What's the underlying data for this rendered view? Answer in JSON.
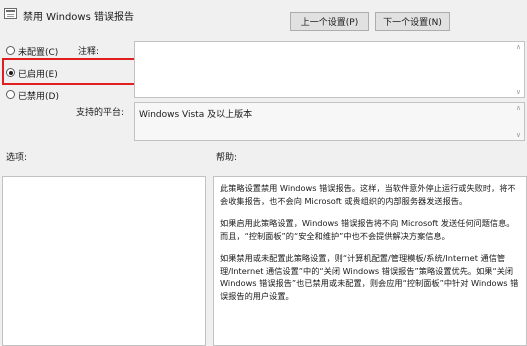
{
  "window": {
    "title": "禁用 Windows 错误报告",
    "icon": "policy-setting-icon"
  },
  "nav": {
    "prev_label": "上一个设置(P)",
    "next_label": "下一个设置(N)"
  },
  "options": {
    "not_configured": "未配置(C)",
    "enabled": "已启用(E)",
    "disabled": "已禁用(D)",
    "selected": "enabled"
  },
  "comment": {
    "label": "注释:",
    "value": ""
  },
  "supported": {
    "label": "支持的平台:",
    "value": "Windows Vista 及以上版本"
  },
  "sections": {
    "options_label": "选项:",
    "help_label": "帮助:"
  },
  "help": {
    "paragraphs": [
      "此策略设置禁用 Windows 错误报告。这样，当软件意外停止运行或失败时，将不会收集报告，也不会向 Microsoft 或贵组织的内部服务器发送报告。",
      "如果启用此策略设置，Windows 错误报告将不向 Microsoft 发送任何问题信息。而且，“控制面板”的“安全和维护”中也不会提供解决方案信息。",
      "如果禁用或未配置此策略设置，则“计算机配置/管理模板/系统/Internet 通信管理/Internet 通信设置”中的“关闭 Windows 错误报告”策略设置优先。如果“关闭 Windows 错误报告”也已禁用或未配置，则会应用“控制面板”中针对 Windows 错误报告的用户设置。"
    ]
  },
  "colors": {
    "highlight": "#e02020",
    "background": "#f0f0f0"
  }
}
